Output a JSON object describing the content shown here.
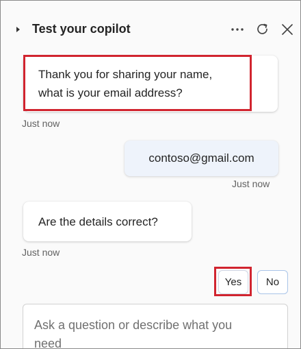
{
  "header": {
    "title": "Test your copilot",
    "icons": [
      "collapse-caret-icon",
      "more-options-icon",
      "refresh-icon",
      "close-icon"
    ]
  },
  "messages": [
    {
      "role": "bot",
      "lines": [
        "Thank you for sharing your name,",
        "what is your email address?"
      ],
      "timestamp": "Just now"
    },
    {
      "role": "user",
      "text": "contoso@gmail.com",
      "timestamp": "Just now"
    },
    {
      "role": "bot",
      "text": "Are the details correct?",
      "timestamp": "Just now"
    }
  ],
  "quick_replies": {
    "yes": "Yes",
    "no": "No"
  },
  "composer": {
    "placeholder_lines": [
      "Ask a question or describe what you",
      "need"
    ]
  },
  "colors": {
    "highlight": "#d1242f",
    "user_bubble": "#eef3fb"
  }
}
